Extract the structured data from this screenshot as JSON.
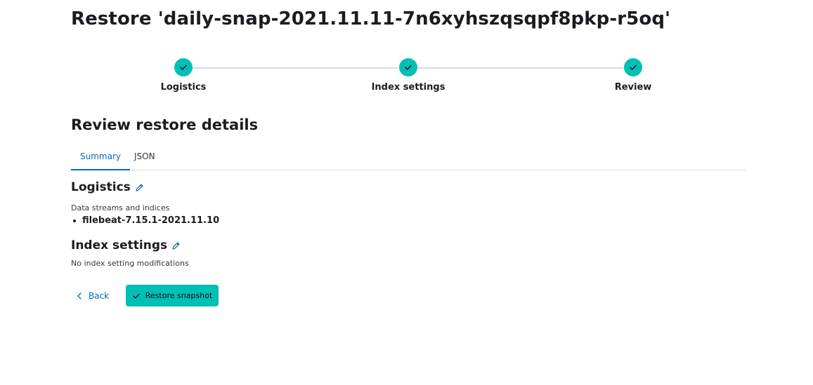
{
  "page": {
    "title": "Restore 'daily-snap-2021.11.11-7n6xyhszqsqpf8pkp-r5oq'"
  },
  "stepper": {
    "steps": [
      {
        "label": "Logistics",
        "status": "complete"
      },
      {
        "label": "Index settings",
        "status": "complete"
      },
      {
        "label": "Review",
        "status": "complete"
      }
    ]
  },
  "review": {
    "title": "Review restore details",
    "tabs": [
      {
        "label": "Summary",
        "selected": true
      },
      {
        "label": "JSON",
        "selected": false
      }
    ]
  },
  "logistics": {
    "title": "Logistics",
    "field_label": "Data streams and indices",
    "indices": [
      "filebeat-7.15.1-2021.11.10"
    ]
  },
  "index_settings": {
    "title": "Index settings",
    "description": "No index setting modifications"
  },
  "actions": {
    "back_label": "Back",
    "restore_label": "Restore snapshot"
  },
  "colors": {
    "accent": "#00bfb3",
    "link": "#006bb8",
    "border": "#d3dae6",
    "text": "#1a1c21"
  },
  "icons": [
    "check-icon",
    "pencil-icon",
    "chevron-left-icon"
  ]
}
